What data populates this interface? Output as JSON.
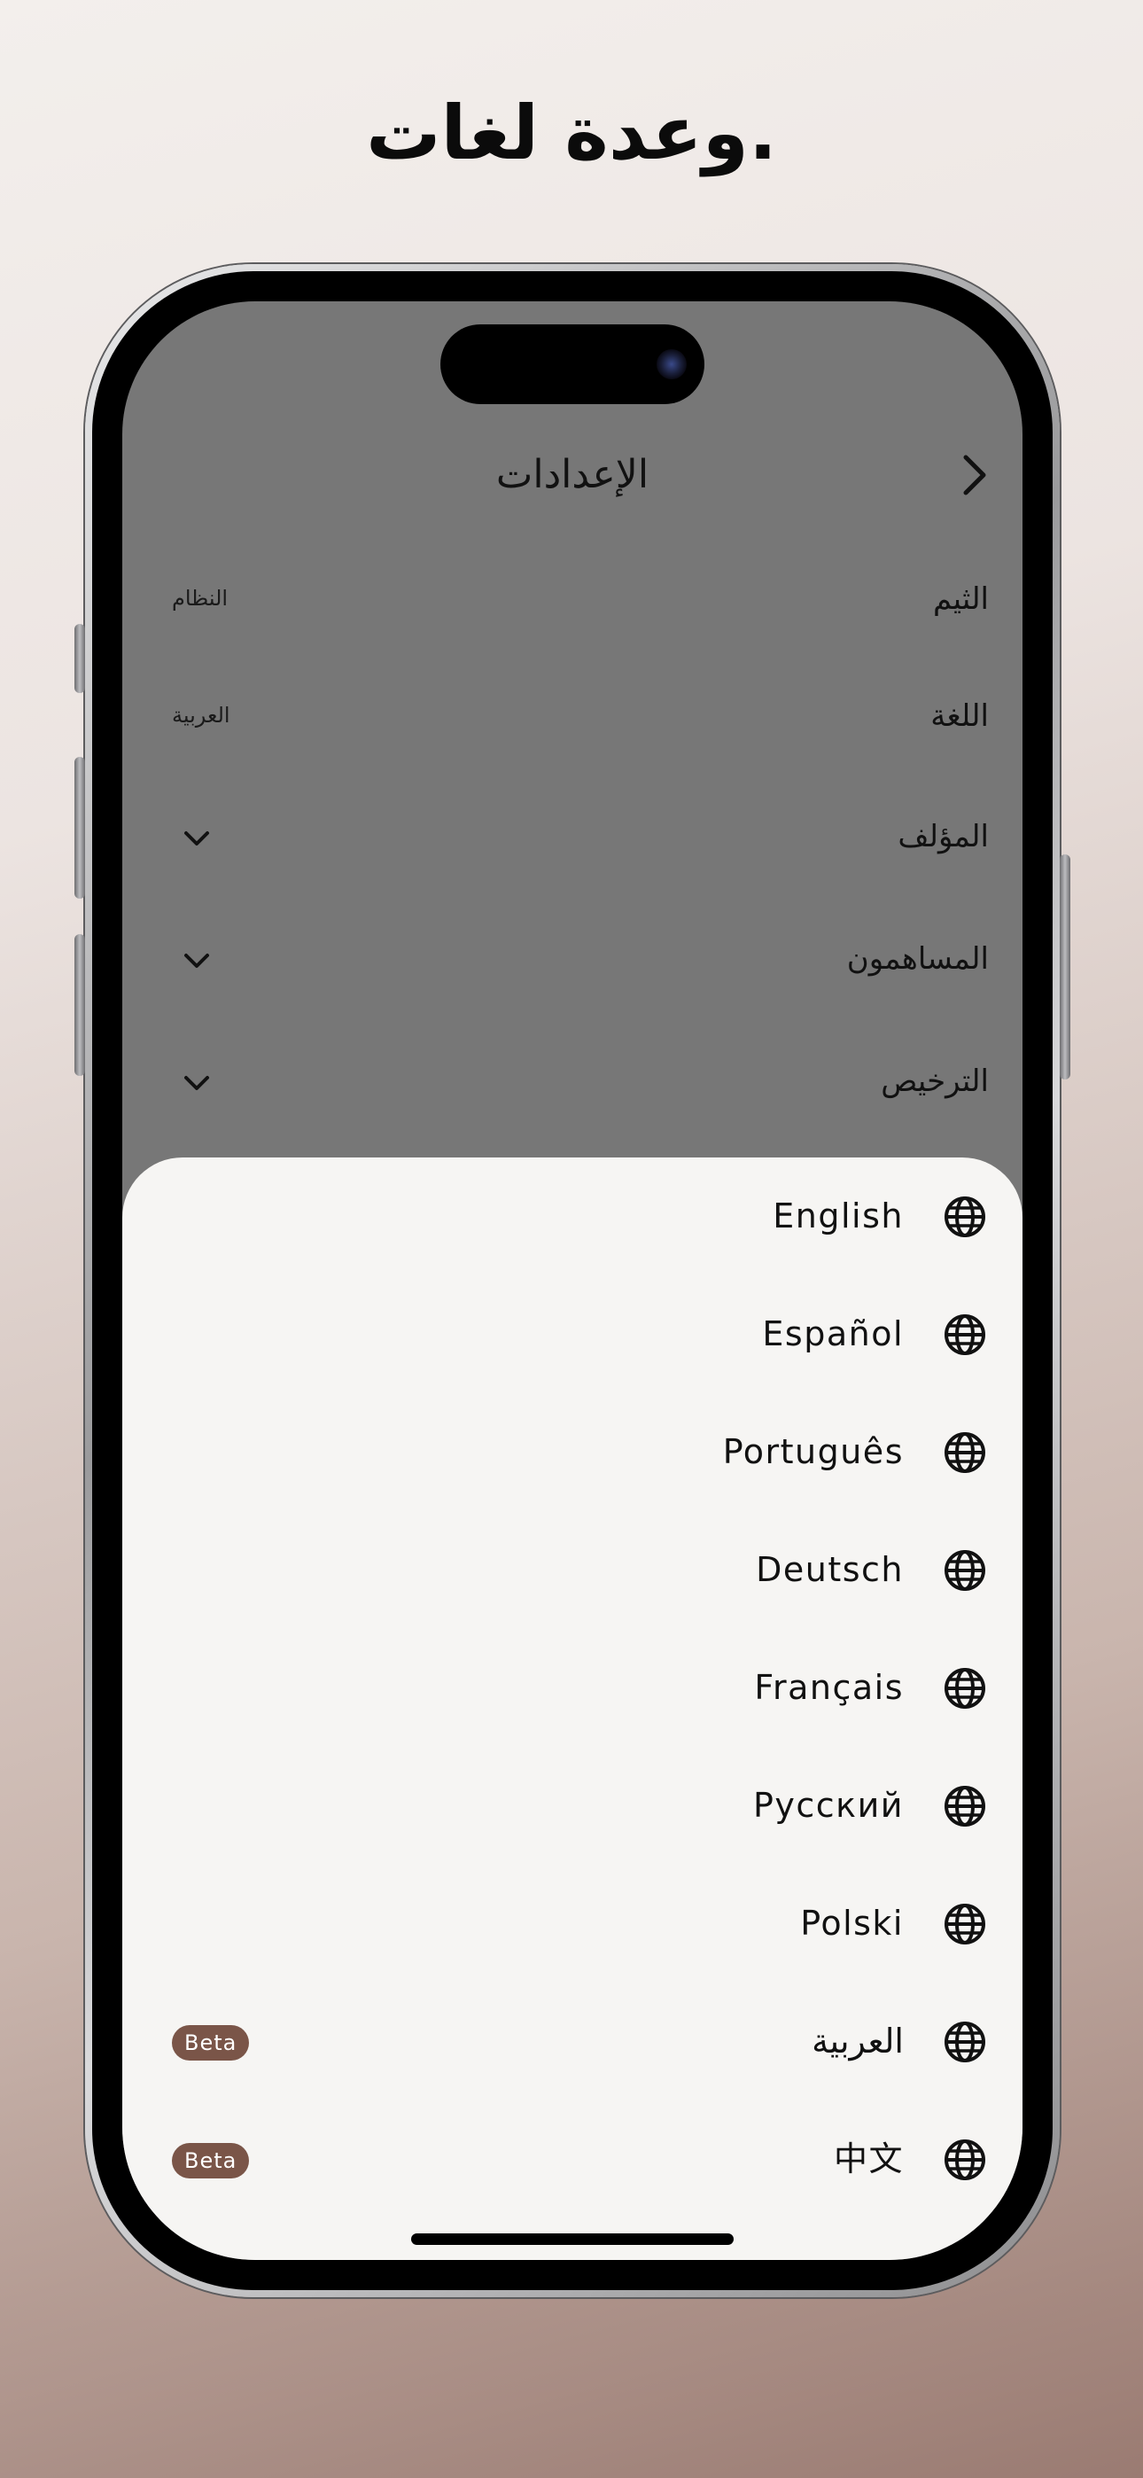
{
  "headline": "وعدة لغات.",
  "settings": {
    "title": "الإعدادات",
    "rows": [
      {
        "label": "الثيم",
        "value": "النظام"
      },
      {
        "label": "اللغة",
        "value": "العربية"
      },
      {
        "label": "المؤلف"
      },
      {
        "label": "المساهمون"
      },
      {
        "label": "الترخيص"
      }
    ]
  },
  "language_sheet": {
    "languages": [
      {
        "label": "English"
      },
      {
        "label": "Español"
      },
      {
        "label": "Português"
      },
      {
        "label": "Deutsch"
      },
      {
        "label": "Français"
      },
      {
        "label": "Русский"
      },
      {
        "label": "Polski"
      },
      {
        "label": "العربية",
        "badge": "Beta"
      },
      {
        "label": "中文",
        "badge": "Beta"
      }
    ]
  },
  "colors": {
    "beta_badge": "#7a5548",
    "sheet_background": "#f6f5f3",
    "dimmed_background": "#777777"
  }
}
